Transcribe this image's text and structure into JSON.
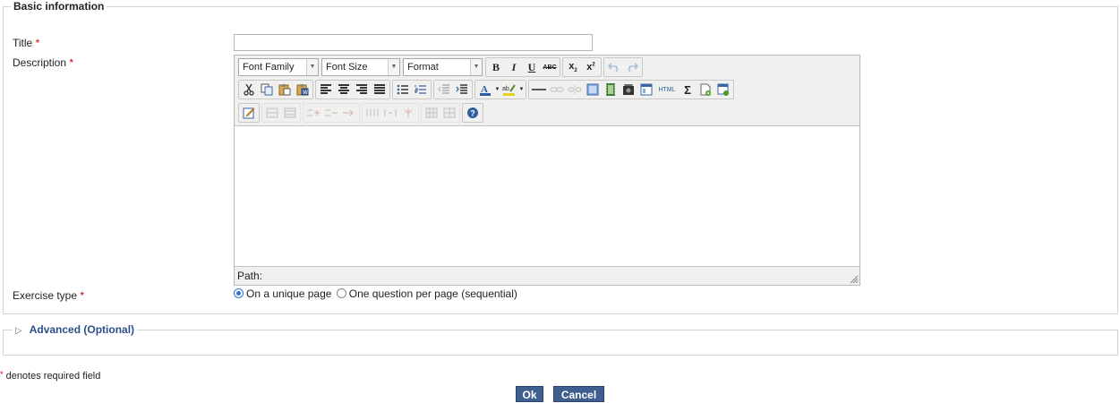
{
  "basic": {
    "legend": "Basic information",
    "title_label": "Title",
    "description_label": "Description",
    "exercise_type_label": "Exercise type",
    "required_marker": "*",
    "title_value": "",
    "options": {
      "unique": "On a unique page",
      "sequential": "One question per page (sequential)"
    },
    "selected_option": "On a unique page"
  },
  "editor": {
    "font_family": "Font Family",
    "font_size": "Font Size",
    "format": "Format",
    "bold": "B",
    "italic": "I",
    "underline": "U",
    "strike": "ABC",
    "html": "HTML",
    "sigma": "Σ",
    "path_label": "Path:",
    "icons_row1": [
      "bold-icon",
      "italic-icon",
      "underline-icon",
      "strikethrough-icon",
      "subscript-icon",
      "superscript-icon",
      "undo-icon",
      "redo-icon"
    ],
    "icons_row2": [
      "cut-icon",
      "copy-icon",
      "paste-icon",
      "paste-word-icon",
      "align-left-icon",
      "align-center-icon",
      "align-right-icon",
      "justify-icon",
      "bullet-list-icon",
      "numbered-list-icon",
      "outdent-icon",
      "indent-icon",
      "text-color-icon",
      "highlight-color-icon",
      "horizontal-rule-icon",
      "link-icon",
      "unlink-icon",
      "image-icon",
      "video-icon",
      "media-icon",
      "template-icon",
      "html-source-icon",
      "math-icon",
      "new-document-icon",
      "preview-icon"
    ],
    "icons_row3": [
      "edit-content-icon",
      "table-row-icon",
      "table-col-icon",
      "insert-row-icon",
      "delete-row-icon",
      "insert-col-icon",
      "delete-col-icon",
      "merge-cells-icon",
      "split-cells-icon",
      "help-icon"
    ]
  },
  "advanced": {
    "label": "Advanced (Optional)",
    "toggle_glyph": "▷"
  },
  "footer": {
    "required_note": "denotes required field",
    "required_marker": "*",
    "ok": "Ok",
    "cancel": "Cancel"
  },
  "colors": {
    "accent": "#3e5f8f",
    "link": "#2b4f8c",
    "required": "#cc0000",
    "toolbar_bg": "#f0f0ee"
  }
}
